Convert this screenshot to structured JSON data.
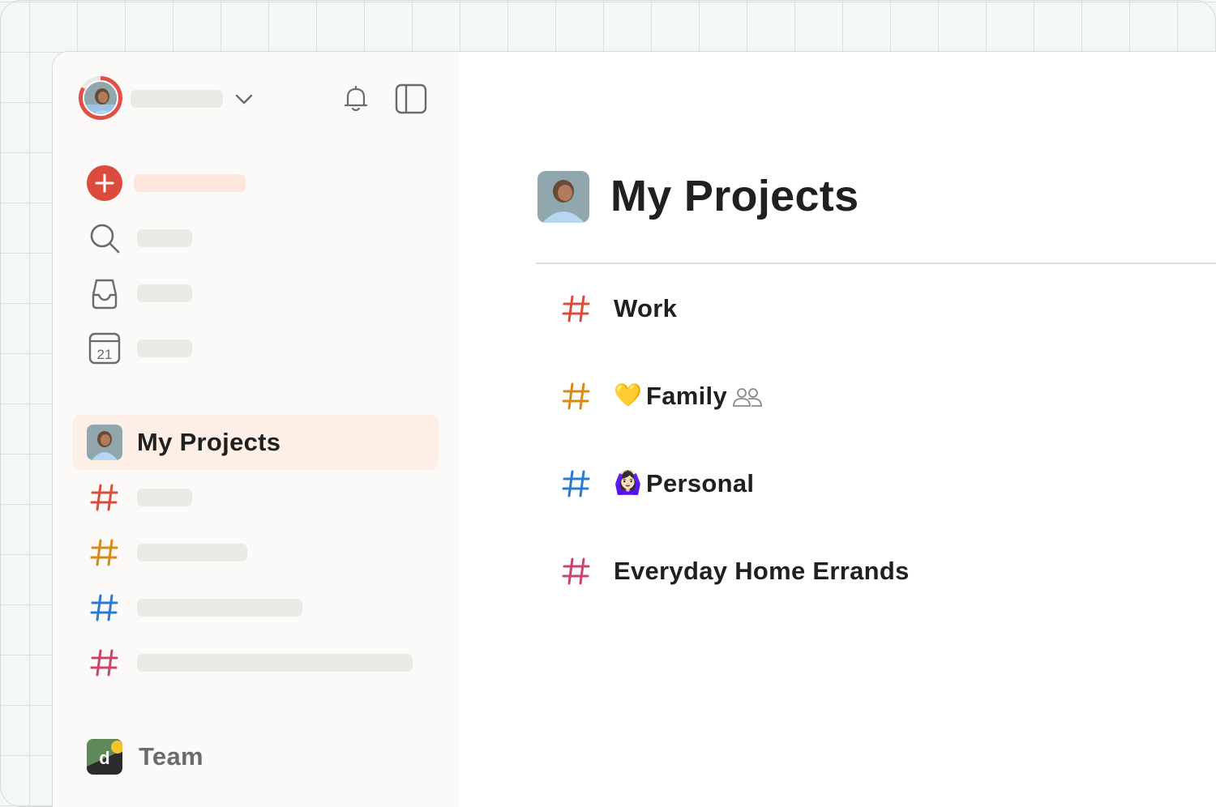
{
  "sidebar": {
    "section_title": "My Projects",
    "team_label": "Team",
    "team_logo_letter": "d"
  },
  "main": {
    "title": "My Projects",
    "projects": [
      {
        "name": "Work",
        "emoji": "",
        "color": "#dc4c3e",
        "shared": false
      },
      {
        "name": "Family",
        "emoji": "💛",
        "color": "#d98a14",
        "shared": true
      },
      {
        "name": "Personal",
        "emoji": "🙆🏻‍♀️",
        "color": "#2a7bd1",
        "shared": false
      },
      {
        "name": "Everyday Home Errands",
        "emoji": "",
        "color": "#c8466e",
        "shared": false
      }
    ]
  },
  "colors": {
    "accent": "#dc4c3e",
    "highlight": "#feefe6",
    "hash_red": "#dc4c3e",
    "hash_orange": "#d98a14",
    "hash_blue": "#2a7bd1",
    "hash_pink": "#c8466e"
  }
}
